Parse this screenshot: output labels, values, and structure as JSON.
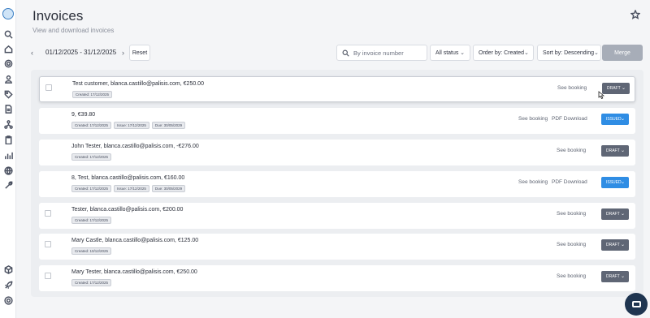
{
  "page": {
    "title": "Invoices",
    "subtitle": "View and download invoices"
  },
  "toolbar": {
    "prev_arrow": "‹",
    "next_arrow": "›",
    "date_range": "01/12/2025 - 31/12/2025",
    "reset_label": "Reset",
    "search_placeholder": "By invoice number",
    "status_filter": "All status",
    "order_by": "Order by: Created",
    "sort_by": "Sort by: Descending",
    "merge_label": "Merge"
  },
  "sidebar": {
    "icons": [
      "logo-icon",
      "search-icon",
      "home-icon",
      "settings-icon",
      "users-icon",
      "tag-icon",
      "document-icon",
      "network-icon",
      "clipboard-icon",
      "chart-icon",
      "globe-icon",
      "wrench-icon",
      "box-icon",
      "rocket-icon",
      "help-icon"
    ]
  },
  "invoices": [
    {
      "title": "Test customer,  blanca.castillo@palisis.com,  €250.00",
      "tags": [
        "Created: 17/12/2025"
      ],
      "see_booking": "See booking",
      "pdf": "",
      "status": "DRAFT",
      "status_type": "draft",
      "checkbox": true,
      "selected": true
    },
    {
      "title": "9,  €39.80",
      "tags": [
        "Created: 17/12/2025",
        "Issue: 17/12/2025",
        "Due: 30/05/2029"
      ],
      "see_booking": "See booking",
      "pdf": "PDF Download",
      "status": "ISSUED",
      "status_type": "issued",
      "checkbox": false,
      "selected": false
    },
    {
      "title": "John Tester,  blanca.castillo@palisis.com,  -€276.00",
      "tags": [
        "Created: 17/12/2025"
      ],
      "see_booking": "See booking",
      "pdf": "",
      "status": "DRAFT",
      "status_type": "draft",
      "checkbox": false,
      "selected": false
    },
    {
      "title": "8,  Test,  blanca.castillo@palisis.com,  €160.00",
      "tags": [
        "Created: 17/12/2025",
        "Issue: 17/12/2025",
        "Due: 30/05/2029"
      ],
      "see_booking": "See booking",
      "pdf": "PDF Download",
      "status": "ISSUED",
      "status_type": "issued",
      "checkbox": false,
      "selected": false
    },
    {
      "title": "Tester,  blanca.castillo@palisis.com,  €200.00",
      "tags": [
        "Created: 17/12/2025"
      ],
      "see_booking": "See booking",
      "pdf": "",
      "status": "DRAFT",
      "status_type": "draft",
      "checkbox": true,
      "selected": false
    },
    {
      "title": "Mary Castle,  blanca.castillo@palisis.com,  €125.00",
      "tags": [
        "Created: 10/12/2025"
      ],
      "see_booking": "See booking",
      "pdf": "",
      "status": "DRAFT",
      "status_type": "draft",
      "checkbox": true,
      "selected": false
    },
    {
      "title": "Mary Tester,  blanca.castillo@palisis.com,  €250.00",
      "tags": [
        "Created: 17/12/2025"
      ],
      "see_booking": "See booking",
      "pdf": "",
      "status": "DRAFT",
      "status_type": "draft",
      "checkbox": true,
      "selected": false
    }
  ],
  "colors": {
    "draft": "#5f6675",
    "issued": "#2f8de4",
    "merge_disabled": "#a7adb8",
    "chat_button": "#1f3550"
  }
}
